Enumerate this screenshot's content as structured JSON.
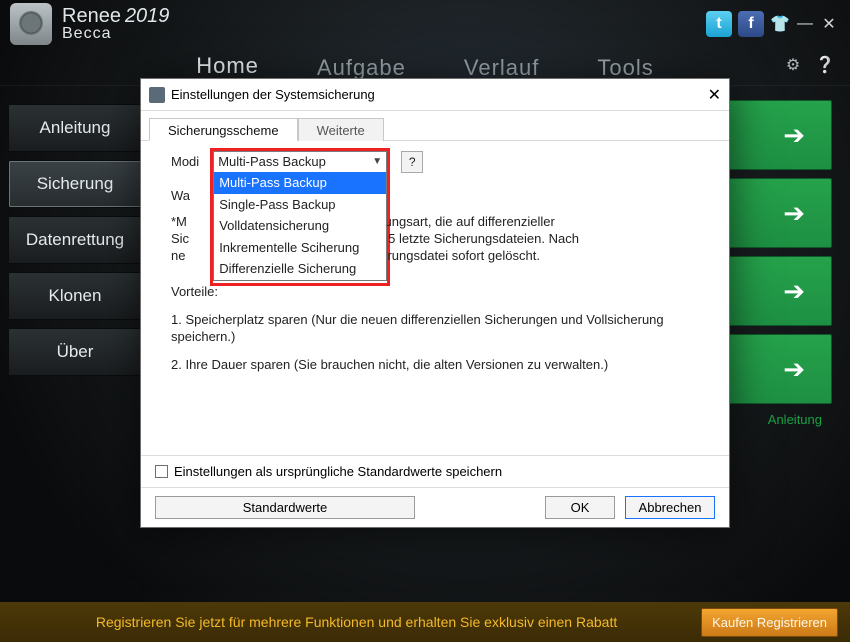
{
  "app": {
    "title_brand": "Renee",
    "title_year": "2019",
    "title_sub": "Becca"
  },
  "nav": {
    "tabs": [
      "Home",
      "Aufgabe",
      "Verlauf",
      "Tools"
    ]
  },
  "sidebar": {
    "items": [
      {
        "label": "Anleitung"
      },
      {
        "label": "Sicherung"
      },
      {
        "label": "Datenrettung"
      },
      {
        "label": "Klonen"
      },
      {
        "label": "Über"
      }
    ],
    "active_index": 1
  },
  "main": {
    "help_link": "Anleitung"
  },
  "footer": {
    "message": "Registrieren Sie jetzt für mehrere Funktionen und erhalten Sie exklusiv einen Rabatt",
    "button": "Kaufen  Registrieren"
  },
  "dialog": {
    "title": "Einstellungen der Systemsicherung",
    "tabs": [
      "Sicherungsscheme",
      "Weiterte"
    ],
    "active_tab": 0,
    "modi_label": "Modi",
    "combo_value": "Multi-Pass Backup",
    "options": [
      "Multi-Pass Backup",
      "Single-Pass Backup",
      "Volldatensicherung",
      "Inkrementelle Sciherung",
      "Differenzielle Sicherung"
    ],
    "selected_option_index": 0,
    "help_btn": "?",
    "wa_line": "Wa",
    "desc_line1_a": "*M",
    "desc_line1_b": "erungsart, die auf differenzieller",
    "desc_line2_a": "Sic",
    "desc_line2_b": "ur 5 letzte Sicherungsdateien. Nach",
    "desc_line3": "nuwwwwwwwwwww wwww wwwwherungsdatei sofort gelöscht.",
    "desc_line3_visible": "herungsdatei sofort gelöscht.",
    "desc_pre_gap": "ne",
    "vorteile": "Vorteile:",
    "adv1": "1. Speicherplatz sparen (Nur die neuen differenziellen Sicherungen und Vollsicherung speichern.)",
    "adv2": "2. Ihre Dauer sparen (Sie brauchen nicht, die alten Versionen zu verwalten.)",
    "save_defaults": "Einstellungen als ursprüngliche Standardwerte speichern",
    "std_btn": "Standardwerte",
    "ok_btn": "OK",
    "cancel_btn": "Abbrechen"
  }
}
